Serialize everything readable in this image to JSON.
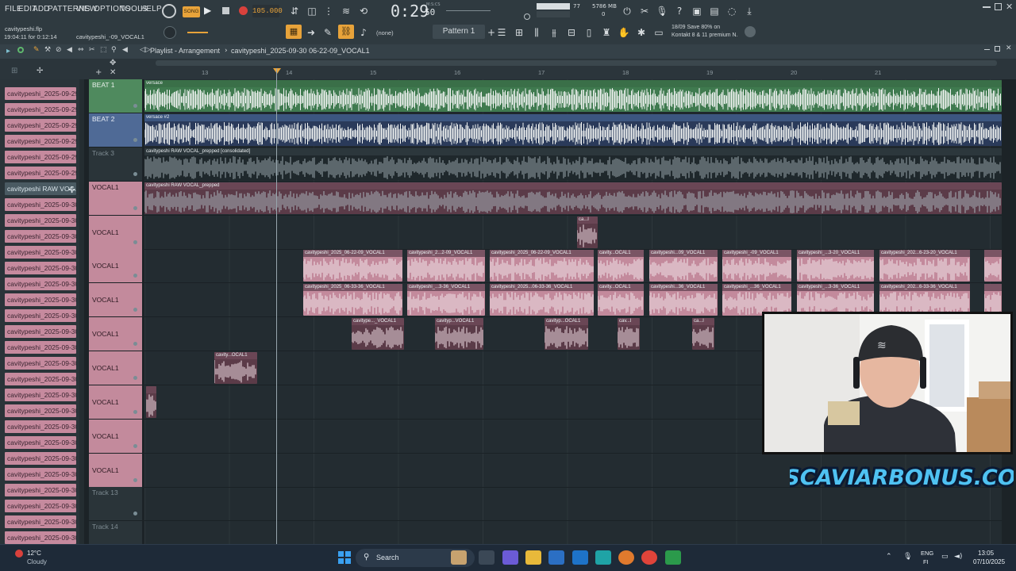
{
  "menu": [
    "FILE",
    "EDIT",
    "ADD",
    "PATTERNS",
    "VIEW",
    "OPTIONS",
    "TOOLS",
    "HELP"
  ],
  "project": {
    "file": "cavitypeshi.flp",
    "time_info": "19:04:11 for 0:12:14",
    "short_name": "cavitypeshi_-09_VOCAL1"
  },
  "transport": {
    "mode": "SONG",
    "tempo": "105.000",
    "time": "0:29",
    "time_frac": "50",
    "time_unit": "M:S:CS",
    "cpu": "77",
    "memory": "5786 MB",
    "voices": "0"
  },
  "pattern": {
    "snap": "(none)",
    "name": "Pattern 1"
  },
  "hint": {
    "line1": "18/09 Save 80% on",
    "line2": "Kontakt 8 & 11 premium N."
  },
  "playlist": {
    "title": "Playlist - Arrangement",
    "breadcrumb": "cavitypeshi_2025-09-30 06-22-09_VOCAL1"
  },
  "ruler": [
    "13",
    "14",
    "15",
    "16",
    "17",
    "18",
    "19",
    "20",
    "21"
  ],
  "browser": {
    "items": [
      "cavitypeshi_2025-09-29...",
      "cavitypeshi_2025-09-29...",
      "cavitypeshi_2025-09-29...",
      "cavitypeshi_2025-09-29...",
      "cavitypeshi_2025-09-29...",
      "cavitypeshi_2025-09-29...",
      "cavitypeshi RAW VOC...",
      "cavitypeshi_2025-09-30...",
      "cavitypeshi_2025-09-30...",
      "cavitypeshi_2025-09-30...",
      "cavitypeshi_2025-09-30...",
      "cavitypeshi_2025-09-30...",
      "cavitypeshi_2025-09-30...",
      "cavitypeshi_2025-09-30...",
      "cavitypeshi_2025-09-30...",
      "cavitypeshi_2025-09-30...",
      "cavitypeshi_2025-09-30...",
      "cavitypeshi_2025-09-30...",
      "cavitypeshi_2025-09-30...",
      "cavitypeshi_2025-09-30...",
      "cavitypeshi_2025-09-30...",
      "cavitypeshi_2025-09-30...",
      "cavitypeshi_2025-09-30...",
      "cavitypeshi_2025-09-30...",
      "cavitypeshi_2025-09-30...",
      "cavitypeshi_2025-09-30...",
      "cavitypeshi_2025-09-30...",
      "cavitypeshi_2025-09-30...",
      "cavitypeshi_2025-09-30..."
    ]
  },
  "tracks": [
    {
      "name": "BEAT 1",
      "clip": "versace",
      "color": "#4f8a5e"
    },
    {
      "name": "BEAT 2",
      "clip": "versace #2",
      "color": "#4f6a96"
    },
    {
      "name": "Track 3",
      "clip": "cavitypeshi RAW VOCAL_prepped [consolidated]"
    },
    {
      "name": "VOCAL1",
      "clip": "cavitypeshi RAW VOCAL_prepped"
    },
    {
      "name": "VOCAL1"
    },
    {
      "name": "VOCAL1"
    },
    {
      "name": "VOCAL1"
    },
    {
      "name": "VOCAL1"
    },
    {
      "name": "VOCAL1"
    },
    {
      "name": "VOCAL1"
    },
    {
      "name": "VOCAL1"
    },
    {
      "name": "VOCAL1"
    },
    {
      "name": "Track 13"
    },
    {
      "name": "Track 14"
    }
  ],
  "clips": {
    "lane5": [
      "ca...l"
    ],
    "lane6": [
      "cavitypeshi_2025_06-22-09_VOCAL1",
      "cavitypeshi_2...2-09_VOCAL1",
      "cavitypeshi_2025_06-22-09_VOCAL1",
      "cavity...OCAL1",
      "cavitypeshi...09_VOCAL1",
      "cavitypeshi_-09_VOCAL1",
      "cavitypeshi_...3-20_VOCAL1",
      "cavitypeshi_202...6-23-20_VOCAL1"
    ],
    "lane7": [
      "cavitypeshi_2025_06-33-36_VOCAL1",
      "cavitypeshi_...3-36_VOCAL1",
      "cavitypeshi_2025...06-33-36_VOCAL1",
      "cavity...OCAL1",
      "cavitypeshi...36_VOCAL1",
      "cavitypeshi_...36_VOCAL1",
      "cavitypeshi_...3-36_VOCAL1",
      "cavitypeshi_202...6-33-36_VOCAL1"
    ],
    "lane8": [
      "cavitype..._VOCAL1",
      "cavityp...VOCAL1",
      "cavityp...OCAL1",
      "cav...l",
      "ca...l"
    ],
    "lane9": [
      "cavity...OCAL1"
    ]
  },
  "webcam_brand": "OSCAVIARBONUS.COM",
  "taskbar": {
    "weather_temp": "12°C",
    "weather_text": "Cloudy",
    "search": "Search",
    "lang1": "ENG",
    "lang2": "FI",
    "clock": "13:05",
    "date": "07/10/2025"
  },
  "colors": {
    "clip_pink": "#c38a9c",
    "beat1_green": "#4f8a5e",
    "beat2_blue": "#4f6a96",
    "tempo_orange": "#e8a33a",
    "record_red": "#d9413c"
  }
}
